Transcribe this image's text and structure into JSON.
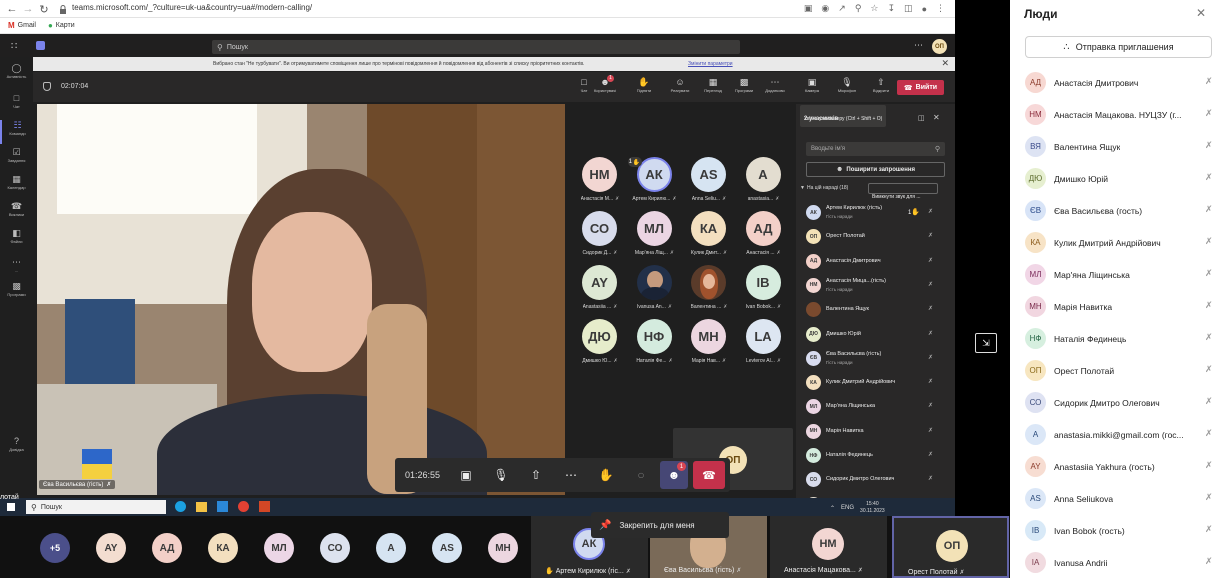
{
  "browser": {
    "url": "teams.microsoft.com/_?culture=uk-ua&country=ua#/modern-calling/",
    "bookmarks": [
      "Gmail",
      "Карти"
    ]
  },
  "teams": {
    "search_placeholder": "Пошук",
    "user_initials": "ОП",
    "rail": [
      {
        "icon": "activity-icon",
        "label": "Активність"
      },
      {
        "icon": "chat-icon",
        "label": "Чат"
      },
      {
        "icon": "teams-icon",
        "label": "Команди"
      },
      {
        "icon": "tasks-icon",
        "label": "Завдання"
      },
      {
        "icon": "calendar-icon",
        "label": "Календар"
      },
      {
        "icon": "calls-icon",
        "label": "Виклики"
      },
      {
        "icon": "files-icon",
        "label": "Файли"
      },
      {
        "icon": "more-icon",
        "label": "..."
      },
      {
        "icon": "apps-icon",
        "label": "Програми"
      },
      {
        "icon": "help-icon",
        "label": "Довідка"
      }
    ],
    "dnd_banner": "Вибрано стан \"Не турбувати\". Ви отримуватимете сповіщення лише про термінові повідомлення й повідомлення від абонентів зі списку пріоритетних контактів.",
    "dnd_link": "Змінити параметри",
    "call_timer": "02:07:04",
    "toolbar": [
      {
        "icon": "chat-icon",
        "label": "Чат"
      },
      {
        "icon": "people-icon",
        "label": "Користувачі",
        "badge": "1"
      },
      {
        "icon": "raise-hand-icon",
        "label": "Підняти"
      },
      {
        "icon": "reactions-icon",
        "label": "Реагувати"
      },
      {
        "icon": "view-icon",
        "label": "Перегляд"
      },
      {
        "icon": "apps-icon",
        "label": "Програми"
      },
      {
        "icon": "more-icon",
        "label": "Додатково"
      },
      {
        "icon": "camera-icon",
        "label": "Камера"
      },
      {
        "icon": "mic-icon",
        "label": "Мікрофон"
      },
      {
        "icon": "share-icon",
        "label": "Відкрити"
      }
    ],
    "leave_label": "Вийти",
    "camera_tooltip": "Увімкнути камеру (Ctrl + Shift + O)",
    "participants_count": "2 учасників",
    "panel_search_placeholder": "Вводьте ім'я",
    "share_invite": "Поширити запрошення",
    "in_meeting": "На цій нараді (18)",
    "mute_all": "Вимкнути звук для ...",
    "main_speaker_label": "Єва Васильєва (гість)",
    "grid": [
      {
        "i": "НМ",
        "n": "Анастасія М...",
        "bg": "#f2d6d2"
      },
      {
        "i": "АК",
        "n": "Артем Кирилю...",
        "bg": "#d0daf0",
        "hand": "1"
      },
      {
        "i": "AS",
        "n": "Anna Seliu...",
        "bg": "#d6e4f2"
      },
      {
        "i": "A",
        "n": "anastasia...",
        "bg": "#e3ddd0"
      },
      {
        "i": "СО",
        "n": "Сидорик Д...",
        "bg": "#d8dcec"
      },
      {
        "i": "МЛ",
        "n": "Мар'яна Ліщ...",
        "bg": "#ebd5e3"
      },
      {
        "i": "КА",
        "n": "Кулик Дмит...",
        "bg": "#f3dfbf"
      },
      {
        "i": "АД",
        "n": "Анастасія ...",
        "bg": "#f3d0c8"
      },
      {
        "i": "AY",
        "n": "Anastasiia ...",
        "bg": "#dde8d4"
      },
      {
        "i": "",
        "n": "Ivanusa An...",
        "bg": "#223049",
        "photo": "man"
      },
      {
        "i": "",
        "n": "Валентина ...",
        "bg": "#5a3b2a",
        "photo": "woman"
      },
      {
        "i": "IB",
        "n": "Ivan Bobok...",
        "bg": "#d6ecde"
      },
      {
        "i": "ДЮ",
        "n": "Дмишко Ю...",
        "bg": "#e6eccb"
      },
      {
        "i": "НФ",
        "n": "Наталія Фе...",
        "bg": "#d4ebde"
      },
      {
        "i": "МН",
        "n": "Марія Нав...",
        "bg": "#ecd6e0"
      },
      {
        "i": "LA",
        "n": "Levterov Al...",
        "bg": "#dde6f2"
      }
    ],
    "self_initials": "ОП",
    "call_bar": {
      "timer": "01:26:55",
      "people_badge": "1"
    },
    "panel_list": [
      {
        "i": "АК",
        "n": "Артем Кирилюк (гість)",
        "s": "Гість наради",
        "bg": "#d0daf0",
        "hand": "1"
      },
      {
        "i": "ОП",
        "n": "Орест Полотай",
        "s": "",
        "bg": "#f3e2b7"
      },
      {
        "i": "АД",
        "n": "Анастасія Дмитрович",
        "s": "",
        "bg": "#f3d0c8"
      },
      {
        "i": "НМ",
        "n": "Анастасія Мица...(гість)",
        "s": "Гість наради",
        "bg": "#f2d6d2"
      },
      {
        "i": "",
        "n": "Валентина Ящук",
        "s": "",
        "bg": "#7a4a2e"
      },
      {
        "i": "ДЮ",
        "n": "Дмишко Юрій",
        "s": "",
        "bg": "#e6eccb"
      },
      {
        "i": "ЄВ",
        "n": "Єва Васильєва (гість)",
        "s": "Гість наради",
        "bg": "#d8dcf0"
      },
      {
        "i": "КА",
        "n": "Кулик Дмитрий Андрійович",
        "s": "",
        "bg": "#f3dfbf"
      },
      {
        "i": "МЛ",
        "n": "Мар'яна Ліщинська",
        "s": "",
        "bg": "#ebd5e3"
      },
      {
        "i": "МН",
        "n": "Марія Навитка",
        "s": "",
        "bg": "#ecd6e0"
      },
      {
        "i": "НФ",
        "n": "Наталія Фединець",
        "s": "",
        "bg": "#d4ebde"
      },
      {
        "i": "СО",
        "n": "Сидорик Дмитро Олегович",
        "s": "",
        "bg": "#d8dcec"
      },
      {
        "i": "A",
        "n": "anastasia.mikki...",
        "s": "",
        "bg": "#e3ddd0"
      }
    ]
  },
  "taskbar": {
    "search": "Пошук",
    "lang": "ENG",
    "time": "15:40",
    "date": "30.11.2023",
    "left_label": "лотай"
  },
  "bottom_strip": {
    "more": "+5",
    "avatars": [
      {
        "i": "AY",
        "bg": "#f3ddd0"
      },
      {
        "i": "АД",
        "bg": "#f3d0c8"
      },
      {
        "i": "КА",
        "bg": "#f3dfbf"
      },
      {
        "i": "МЛ",
        "bg": "#ecd6e6"
      },
      {
        "i": "СО",
        "bg": "#dde2ef"
      },
      {
        "i": "A",
        "bg": "#d6e4f2"
      },
      {
        "i": "AS",
        "bg": "#d6e4f2"
      },
      {
        "i": "МН",
        "bg": "#ecd6e0"
      }
    ],
    "tiles": [
      {
        "i": "АК",
        "n": "Артем Кирилюк (гіс...",
        "bg": "#d0daf0"
      },
      {
        "i": "",
        "n": "Єва Васильєва (гість)",
        "bg": "#caa98a"
      },
      {
        "i": "НМ",
        "n": "Анастасія Мацакова...",
        "bg": "#f2d6d2"
      },
      {
        "i": "ОП",
        "n": "Орест Полотай",
        "bg": "#f3e2b7"
      }
    ],
    "pin_tooltip": "Закрепить для меня"
  },
  "people": {
    "title": "Люди",
    "invite": "Отправка приглашения",
    "list": [
      {
        "i": "АД",
        "n": "Анастасія Дмитрович",
        "bg": "#f7d8d2",
        "fg": "#8a3a2a"
      },
      {
        "i": "НМ",
        "n": "Анастасія Мацакова. НУЦЗУ (г...",
        "bg": "#f7d8d8",
        "fg": "#8a2a3a"
      },
      {
        "i": "ВЯ",
        "n": "Валентина Ящук",
        "bg": "#dde3f3",
        "fg": "#3a4a8a"
      },
      {
        "i": "ДЮ",
        "n": "Дмишко Юрій",
        "bg": "#e6efd0",
        "fg": "#5a6a2a"
      },
      {
        "i": "ЄВ",
        "n": "Єва Васильєва (гость)",
        "bg": "#d8e4f7",
        "fg": "#2a4a8a"
      },
      {
        "i": "КА",
        "n": "Кулик Дмитрий Андрійович",
        "bg": "#f7e3c6",
        "fg": "#8a5a1a"
      },
      {
        "i": "МЛ",
        "n": "Мар'яна Ліщинська",
        "bg": "#f1d6e6",
        "fg": "#7a2a5a"
      },
      {
        "i": "МН",
        "n": "Марія Навитка",
        "bg": "#f1d6e0",
        "fg": "#7a2a4a"
      },
      {
        "i": "НФ",
        "n": "Наталія Фединець",
        "bg": "#d6efdf",
        "fg": "#2a6a4a"
      },
      {
        "i": "ОП",
        "n": "Орест Полотай",
        "bg": "#f7e6c0",
        "fg": "#8a6a1a"
      },
      {
        "i": "СО",
        "n": "Сидорик Дмитро Олегович",
        "bg": "#dee2f2",
        "fg": "#3a4a7a"
      },
      {
        "i": "A",
        "n": "anastasia.mikki@gmail.com (гос...",
        "bg": "#dbe7f7",
        "fg": "#2a4a7a"
      },
      {
        "i": "AY",
        "n": "Anastasiia Yakhura (гость)",
        "bg": "#f7ddd2",
        "fg": "#8a3a2a"
      },
      {
        "i": "AS",
        "n": "Anna Seliukova",
        "bg": "#dbe7f7",
        "fg": "#2a4a7a"
      },
      {
        "i": "IB",
        "n": "Ivan Bobok (гость)",
        "bg": "#d8e9f7",
        "fg": "#2a4a7a"
      },
      {
        "i": "IA",
        "n": "Ivanusa Andrii",
        "bg": "#f1dbe0",
        "fg": "#7a3a4a"
      }
    ]
  }
}
